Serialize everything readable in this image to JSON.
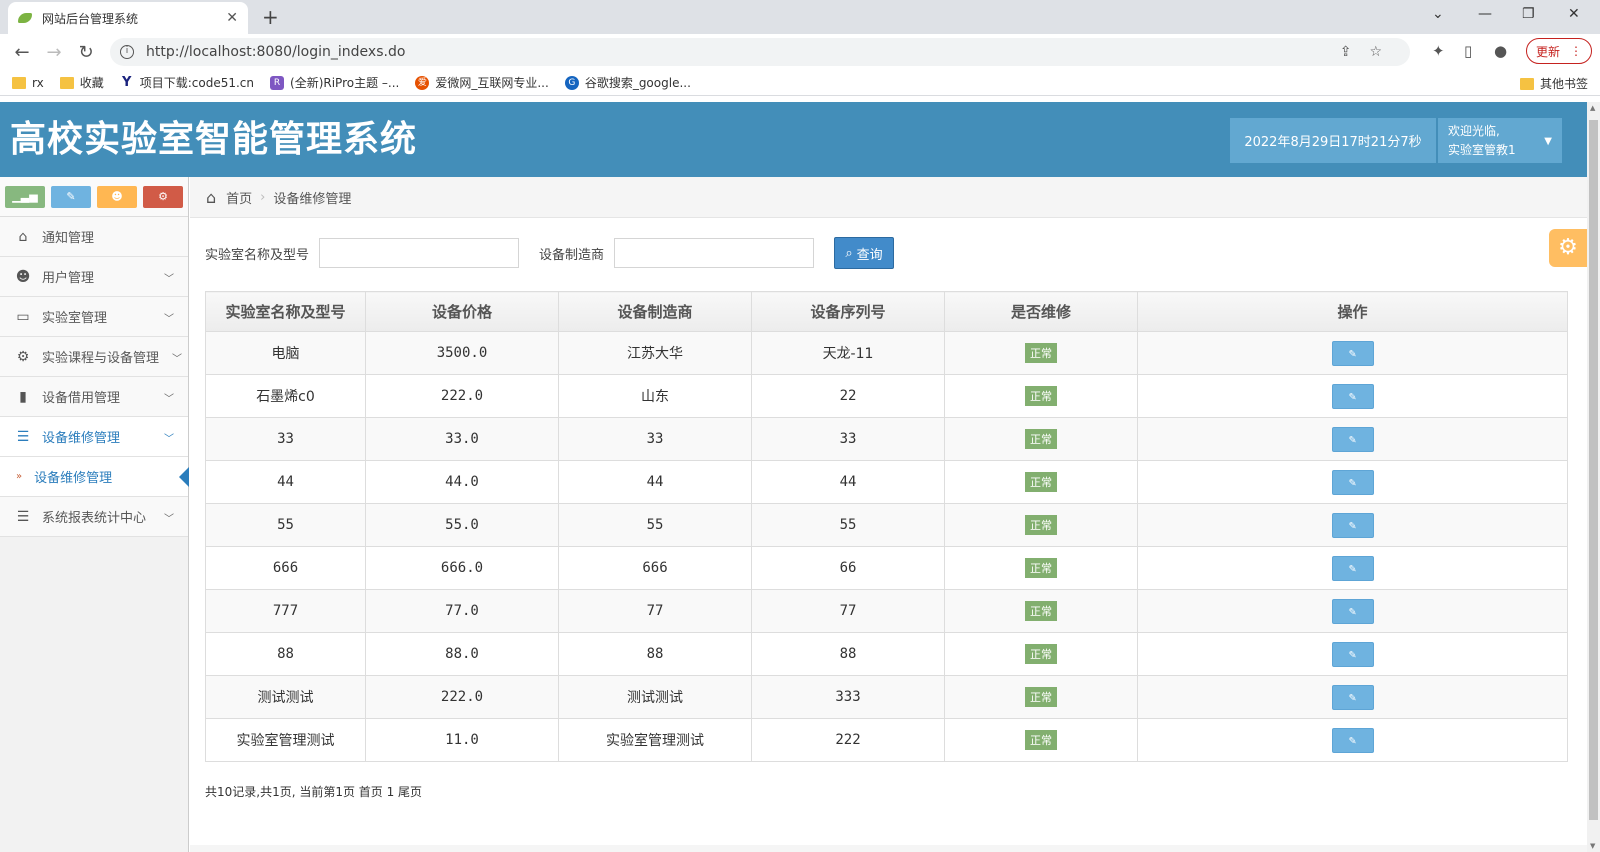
{
  "browser": {
    "tab_title": "网站后台管理系统",
    "url": "http://localhost:8080/login_indexs.do",
    "update_label": "更新",
    "bookmarks": [
      "rx",
      "收藏",
      "项目下载:code51.cn",
      "(全新)RiPro主题 –...",
      "爱微网_互联网专业...",
      "谷歌搜索_google..."
    ],
    "other_bookmarks": "其他书签"
  },
  "header": {
    "brand": "高校实验室智能管理系统",
    "clock": "2022年8月29日17时21分7秒",
    "welcome": "欢迎光临,",
    "user": "实验室管教1"
  },
  "sidebar": {
    "items": [
      {
        "label": "通知管理",
        "icon": "home-icon"
      },
      {
        "label": "用户管理",
        "icon": "users-icon"
      },
      {
        "label": "实验室管理",
        "icon": "desktop-icon"
      },
      {
        "label": "实验课程与设备管理",
        "icon": "cogs-icon"
      },
      {
        "label": "设备借用管理",
        "icon": "bookmark-icon"
      },
      {
        "label": "设备维修管理",
        "icon": "list-icon"
      },
      {
        "label": "系统报表统计中心",
        "icon": "list-icon"
      }
    ],
    "sub_item": "设备维修管理"
  },
  "breadcrumb": {
    "home": "首页",
    "current": "设备维修管理"
  },
  "search": {
    "label1": "实验室名称及型号",
    "label2": "设备制造商",
    "button": "查询"
  },
  "table": {
    "headers": [
      "实验室名称及型号",
      "设备价格",
      "设备制造商",
      "设备序列号",
      "是否维修",
      "操作"
    ],
    "rows": [
      [
        "电脑",
        "3500.0",
        "江苏大华",
        "天龙-11",
        "正常"
      ],
      [
        "石墨烯c0",
        "222.0",
        "山东",
        "22",
        "正常"
      ],
      [
        "33",
        "33.0",
        "33",
        "33",
        "正常"
      ],
      [
        "44",
        "44.0",
        "44",
        "44",
        "正常"
      ],
      [
        "55",
        "55.0",
        "55",
        "55",
        "正常"
      ],
      [
        "666",
        "666.0",
        "666",
        "66",
        "正常"
      ],
      [
        "777",
        "77.0",
        "77",
        "77",
        "正常"
      ],
      [
        "88",
        "88.0",
        "88",
        "88",
        "正常"
      ],
      [
        "测试测试",
        "222.0",
        "测试测试",
        "333",
        "正常"
      ],
      [
        "实验室管理测试",
        "11.0",
        "实验室管理测试",
        "222",
        "正常"
      ]
    ]
  },
  "pager": "共10记录,共1页, 当前第1页 首页 1 尾页"
}
